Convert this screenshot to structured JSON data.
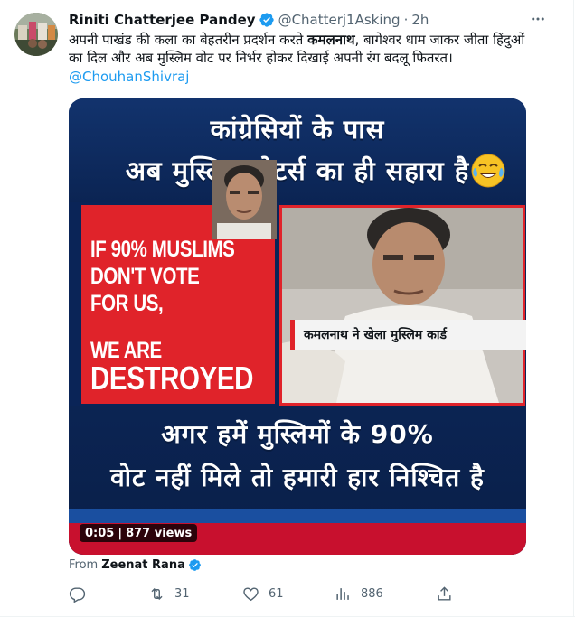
{
  "tweet": {
    "author": {
      "display_name": "Riniti Chatterjee Pandey",
      "handle": "@Chatterj1Asking",
      "verified": true
    },
    "separator": "·",
    "time": "2h",
    "text": {
      "part1": "अपनी पाखंड की कला का बेहतरीन प्रदर्शन करते ",
      "bold": "कमलनाथ",
      "part2": ", बागेश्वर धाम जाकर जीता हिंदुओं का दिल और अब मुस्लिम वोट पर निर्भर होकर दिखाई अपनी रंग बदलू फितरत।"
    },
    "mention": "@ChouhanShivraj",
    "more_icon": "more-horizontal-icon"
  },
  "media": {
    "headline_top_line1": "कांग्रेसियों के पास",
    "headline_top_line2": "अब मुस्लिम वोटर्स का ही सहारा है",
    "quote_lines": [
      "IF 90% MUSLIMS",
      "DON'T VOTE",
      "FOR US,",
      "WE ARE",
      "DESTROYED"
    ],
    "caption_banner": "कमलनाथ ने खेला मुस्लिम कार्ड",
    "headline_bottom_line1": "अगर हमें मुस्लिमों के 90%",
    "headline_bottom_line2": "वोट नहीं मिले तो हमारी हार निश्चित है",
    "video_time": "0:05",
    "video_views": "877 views"
  },
  "attribution": {
    "prefix": "From",
    "name": "Zeenat Rana",
    "verified": true
  },
  "actions": {
    "reply": {
      "icon": "reply-icon",
      "count": ""
    },
    "retweet": {
      "icon": "retweet-icon",
      "count": "31"
    },
    "like": {
      "icon": "heart-icon",
      "count": "61"
    },
    "views": {
      "icon": "views-bar-chart-icon",
      "count": "886"
    },
    "share": {
      "icon": "share-icon",
      "count": ""
    }
  },
  "colors": {
    "text_primary": "#0f1419",
    "text_secondary": "#536471",
    "link": "#1d9bf0",
    "verified_badge": "#1d9bf0",
    "media_navy": "#0a2457",
    "media_red": "#e0232a"
  }
}
